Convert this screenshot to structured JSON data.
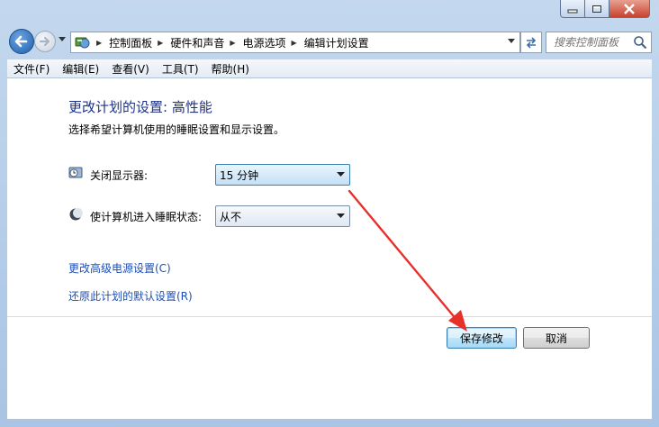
{
  "window": {
    "minimize_icon": "minimize-icon",
    "maximize_icon": "maximize-icon",
    "close_icon": "close-icon"
  },
  "address_bar": {
    "breadcrumbs": [
      "控制面板",
      "硬件和声音",
      "电源选项",
      "编辑计划设置"
    ],
    "search_placeholder": "搜索控制面板"
  },
  "menu": {
    "items": [
      "文件(F)",
      "编辑(E)",
      "查看(V)",
      "工具(T)",
      "帮助(H)"
    ]
  },
  "main": {
    "title": "更改计划的设置: 高性能",
    "subtitle": "选择希望计算机使用的睡眠设置和显示设置。",
    "display_off": {
      "label": "关闭显示器:",
      "value": "15 分钟"
    },
    "sleep": {
      "label": "使计算机进入睡眠状态:",
      "value": "从不"
    },
    "link_advanced": "更改高级电源设置(C)",
    "link_restore": "还原此计划的默认设置(R)",
    "save_label": "保存修改",
    "cancel_label": "取消"
  },
  "annotation": {
    "arrow_color": "#e8302a"
  }
}
